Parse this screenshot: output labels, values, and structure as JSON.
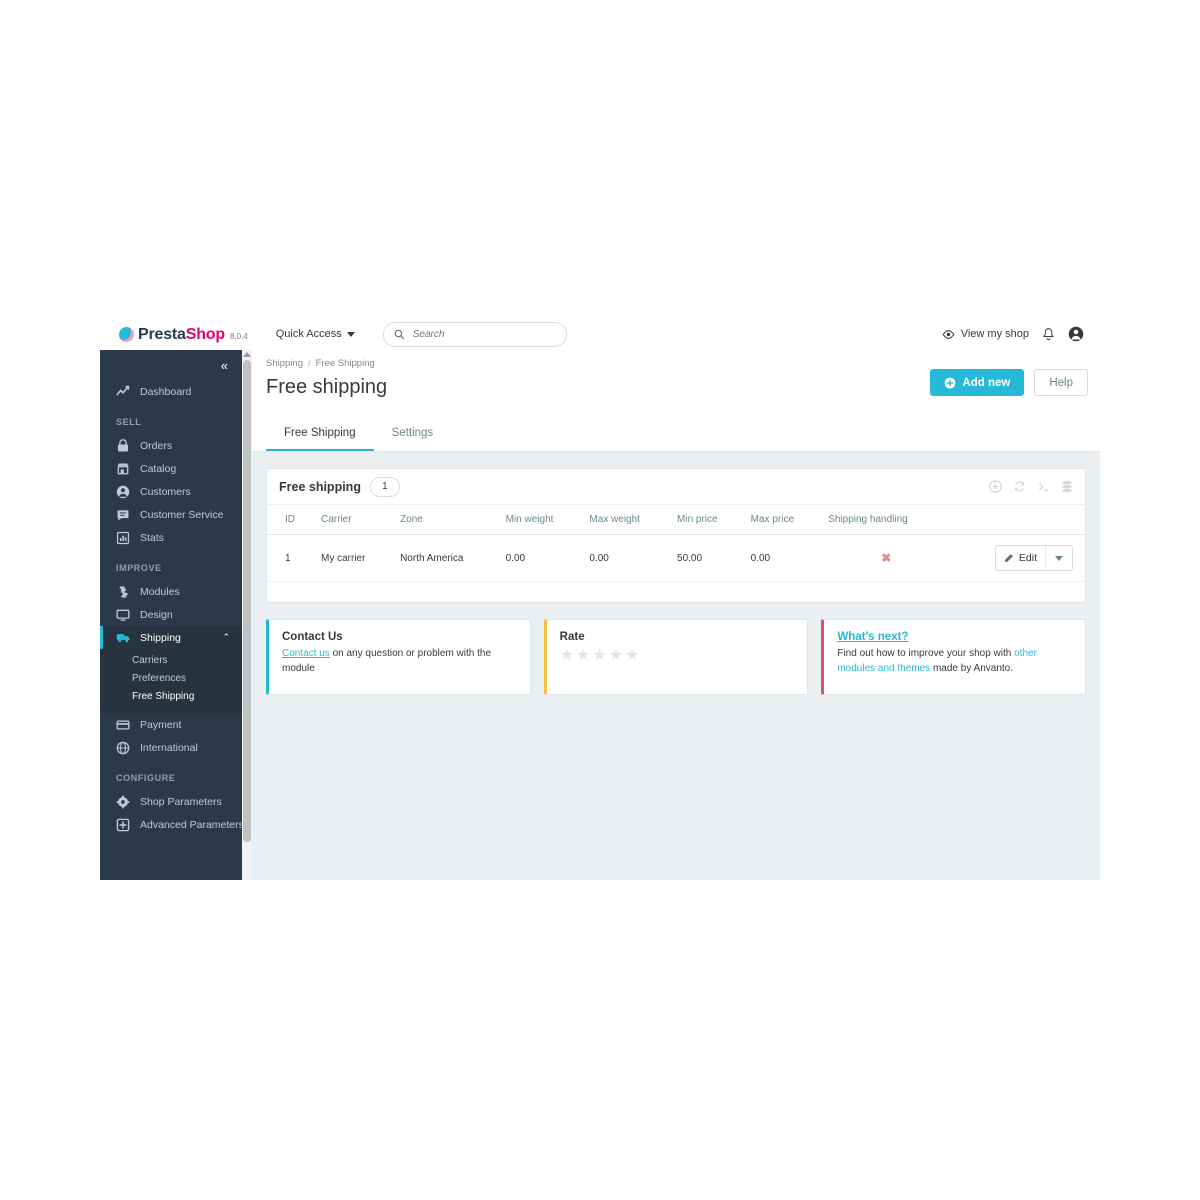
{
  "header": {
    "logo_presta": "Presta",
    "logo_shop": "Shop",
    "version": "8.0.4",
    "quick_access": "Quick Access",
    "search_placeholder": "Search",
    "search_value": "",
    "view_my_shop": "View my shop"
  },
  "sidebar": {
    "collapse_glyph": "«",
    "dashboard": {
      "label": "Dashboard",
      "icon": "trending-up-icon"
    },
    "sections": [
      {
        "title": "SELL",
        "items": [
          {
            "label": "Orders",
            "icon": "basket-icon"
          },
          {
            "label": "Catalog",
            "icon": "store-icon"
          },
          {
            "label": "Customers",
            "icon": "person-circle-icon"
          },
          {
            "label": "Customer Service",
            "icon": "chat-icon"
          },
          {
            "label": "Stats",
            "icon": "bar-chart-icon"
          }
        ]
      },
      {
        "title": "IMPROVE",
        "items": [
          {
            "label": "Modules",
            "icon": "puzzle-icon"
          },
          {
            "label": "Design",
            "icon": "monitor-icon"
          },
          {
            "label": "Shipping",
            "icon": "truck-icon",
            "active": true,
            "chevron": "⌃",
            "children": [
              {
                "label": "Carriers"
              },
              {
                "label": "Preferences"
              },
              {
                "label": "Free Shipping",
                "current": true
              }
            ]
          },
          {
            "label": "Payment",
            "icon": "credit-card-icon"
          },
          {
            "label": "International",
            "icon": "globe-icon"
          }
        ]
      },
      {
        "title": "CONFIGURE",
        "items": [
          {
            "label": "Shop Parameters",
            "icon": "gear-icon"
          },
          {
            "label": "Advanced Parameters",
            "icon": "sliders-icon"
          }
        ]
      }
    ]
  },
  "page": {
    "breadcrumb": [
      "Shipping",
      "Free Shipping"
    ],
    "breadcrumb_separator": "/",
    "title": "Free shipping",
    "add_new": "Add new",
    "help": "Help",
    "tabs": [
      {
        "label": "Free Shipping",
        "active": true
      },
      {
        "label": "Settings",
        "active": false
      }
    ]
  },
  "panel": {
    "title": "Free shipping",
    "count": "1",
    "tools": [
      "plus-circle-icon",
      "refresh-icon",
      "terminal-icon",
      "database-icon"
    ],
    "columns": [
      "ID",
      "Carrier",
      "Zone",
      "Min weight",
      "Max weight",
      "Min price",
      "Max price",
      "Shipping handling"
    ],
    "rows": [
      {
        "id": "1",
        "carrier": "My carrier",
        "zone": "North America",
        "min_weight": "0.00",
        "max_weight": "0.00",
        "min_price": "50.00",
        "max_price": "0.00",
        "shipping_handling": "✖",
        "edit_label": "Edit"
      }
    ]
  },
  "cards": {
    "contact": {
      "title": "Contact Us",
      "link": "Contact us",
      "text": " on any question or problem with the module"
    },
    "rate": {
      "title": "Rate",
      "stars": 5,
      "filled": 0,
      "star_glyph": "★"
    },
    "next": {
      "title": "What's next?",
      "text_before": "Find out how to improve your shop with ",
      "link": "other modules and themes",
      "text_after": " made by Anvanto."
    }
  },
  "colors": {
    "accent": "#25b9d7",
    "sidebar": "#2b3a4a",
    "sidebar_active": "#27333f",
    "brand_pink": "#e5006f",
    "card_yellow": "#f5c33b",
    "card_red": "#d9536f",
    "content_bg": "#eceff1"
  }
}
